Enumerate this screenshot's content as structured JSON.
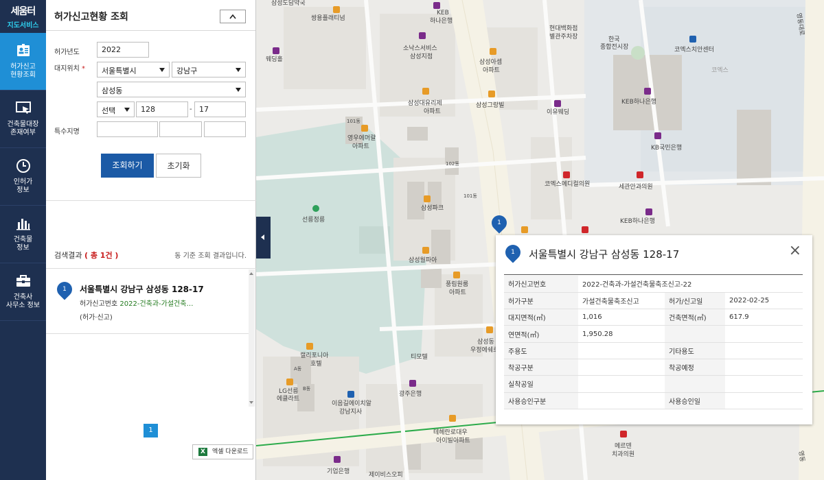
{
  "brand": {
    "line1": "세움터",
    "line2": "지도서비스"
  },
  "nav": [
    {
      "label1": "허가신고",
      "label2": "현황조회",
      "icon": "id-card-icon",
      "active": true
    },
    {
      "label1": "건축물대장",
      "label2": "존재여부",
      "icon": "cursor-screen-icon",
      "active": false
    },
    {
      "label1": "인허가",
      "label2": "정보",
      "icon": "clock-icon",
      "active": false
    },
    {
      "label1": "건축물",
      "label2": "정보",
      "icon": "bar-chart-icon",
      "active": false
    },
    {
      "label1": "건축사",
      "label2": "사무소 정보",
      "icon": "briefcase-icon",
      "active": false
    }
  ],
  "panel": {
    "title": "허가신고현황 조회",
    "collapse": "^",
    "form": {
      "year_label": "허가년도",
      "year_value": "2022",
      "site_label": "대지위치",
      "required_mark": "*",
      "sido": "서울특별시",
      "sigungu": "강남구",
      "dong": "삼성동",
      "type": "선택",
      "bonbun": "128",
      "dash": "-",
      "bubun": "17",
      "special_label": "특수지명"
    },
    "search_btn": "조회하기",
    "reset_btn": "초기화",
    "results": {
      "label": "검색결과",
      "count": "( 총 1건 )",
      "note": "동 기준 조회 결과입니다.",
      "items": [
        {
          "num": "1",
          "title": "서울특별시 강남구 삼성동 128-17",
          "sub_label": "허가신고번호",
          "sub_value": "2022-건축과-가설건축…",
          "type": "(허가·신고)"
        }
      ]
    },
    "page": "1",
    "excel": "엑셀 다운로드"
  },
  "map": {
    "labels": [
      "삼성도담약국",
      "쌍용플래티넘",
      "KEB",
      "하나은행",
      "웨딩홀",
      "소낙스서비스",
      "삼성지점",
      "삼성아셈",
      "아파트",
      "현대백화점",
      "별관주차장",
      "한국",
      "종합전시장",
      "코엑스치안센터",
      "삼성대유리제",
      "아파트",
      "삼성그랑빌",
      "이유웨딩",
      "KEB하나은행",
      "영우에머랄",
      "아파트",
      "KB국민은행",
      "코엑스메디컬의원",
      "세관안과의원",
      "삼성파크",
      "선릉정릉",
      "KEB하나은행",
      "삼성월파아",
      "풍림원룸",
      "아파트",
      "캘리포니아",
      "호텔",
      "티모텔",
      "LG선릉",
      "에클라트",
      "광주은행",
      "이음길에이치알",
      "강남지사",
      "삼성동",
      "우정에쉐르",
      "테헤란로대우",
      "아이빌아파트",
      "기업은행",
      "제이비스오피",
      "메르덴",
      "치과의원",
      "영동대로",
      "102동",
      "101동",
      "101동",
      "A동",
      "B동",
      "코엑스",
      "영동"
    ]
  },
  "popup": {
    "num": "1",
    "title": "서울특별시 강남구 삼성동 128-17",
    "close": "×",
    "rows": [
      {
        "k1": "허가신고번호",
        "v1": "2022-건축과-가설건축물축조신고-22",
        "span": true
      },
      {
        "k1": "허가구분",
        "v1": "가설건축물축조신고",
        "k2": "허가/신고일",
        "v2": "2022-02-25"
      },
      {
        "k1": "대지면적(㎡)",
        "v1": "1,016",
        "k2": "건축면적(㎡)",
        "v2": "617.9"
      },
      {
        "k1": "연면적(㎡)",
        "v1": "1,950.28",
        "k2": "",
        "v2": ""
      },
      {
        "k1": "주용도",
        "v1": "",
        "k2": "기타용도",
        "v2": ""
      },
      {
        "k1": "착공구분",
        "v1": "",
        "k2": "착공예정",
        "v2": ""
      },
      {
        "k1": "실착공일",
        "v1": "",
        "k2": "",
        "v2": ""
      },
      {
        "k1": "사용승인구분",
        "v1": "",
        "k2": "사용승인일",
        "v2": ""
      }
    ]
  },
  "colors": {
    "nav_bg": "#1e3050",
    "nav_active": "#1f8fd6",
    "primary_btn": "#1b5aa6",
    "pin": "#1f61b0",
    "required": "#c81e1e",
    "result_green": "#227a1e"
  }
}
